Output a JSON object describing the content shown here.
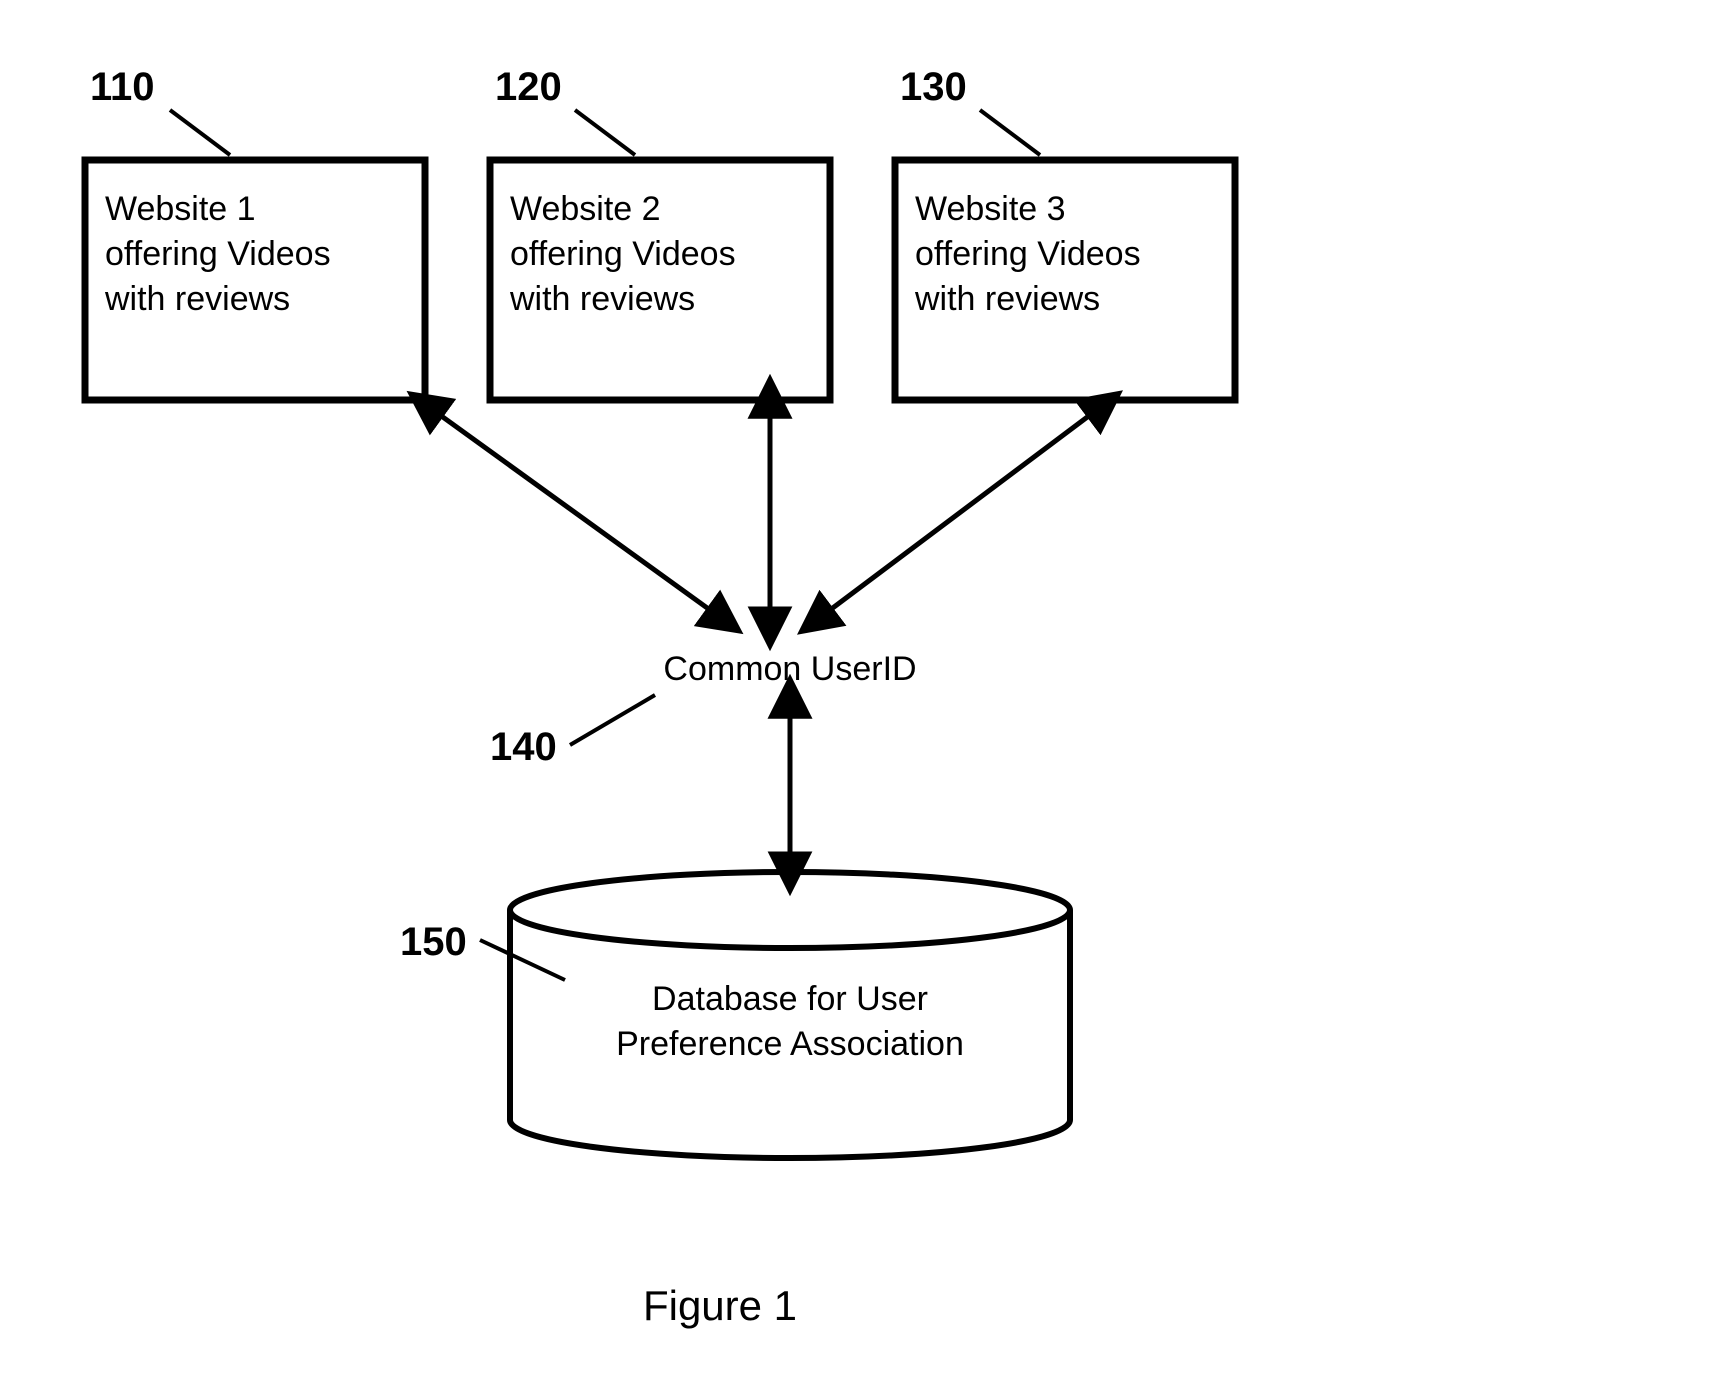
{
  "refs": {
    "r110": "110",
    "r120": "120",
    "r130": "130",
    "r140": "140",
    "r150": "150"
  },
  "boxes": {
    "b1": {
      "l1": "Website 1",
      "l2": "offering Videos",
      "l3": "with reviews"
    },
    "b2": {
      "l1": "Website 2",
      "l2": "offering Videos",
      "l3": "with reviews"
    },
    "b3": {
      "l1": "Website 3",
      "l2": "offering Videos",
      "l3": "with reviews"
    }
  },
  "center": {
    "label": "Common UserID"
  },
  "db": {
    "l1": "Database for User",
    "l2": "Preference Association"
  },
  "figure": "Figure 1"
}
